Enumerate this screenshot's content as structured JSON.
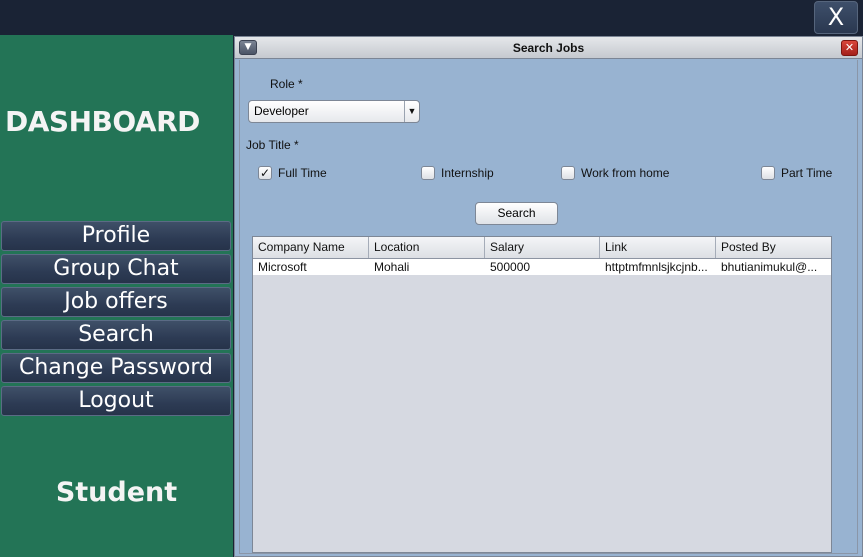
{
  "app": {
    "close_label": "X"
  },
  "sidebar": {
    "title": "DASHBOARD",
    "items": [
      {
        "label": "Profile"
      },
      {
        "label": "Group Chat"
      },
      {
        "label": "Job offers"
      },
      {
        "label": "Search"
      },
      {
        "label": "Change Password"
      },
      {
        "label": "Logout"
      }
    ],
    "user_role": "Student"
  },
  "frame": {
    "title": "Search Jobs",
    "menu_icon": "▼",
    "close_icon": "✕"
  },
  "form": {
    "role_label": "Role *",
    "role_value": "Developer",
    "job_title_label": "Job Title *",
    "checkboxes": [
      {
        "label": "Full Time",
        "checked": true,
        "mark": "✓"
      },
      {
        "label": "Internship",
        "checked": false,
        "mark": ""
      },
      {
        "label": "Work from home",
        "checked": false,
        "mark": ""
      },
      {
        "label": "Part Time",
        "checked": false,
        "mark": ""
      }
    ],
    "search_label": "Search"
  },
  "table": {
    "columns": [
      "Company Name",
      "Location",
      "Salary",
      "Link",
      "Posted By"
    ],
    "rows": [
      [
        "Microsoft",
        "Mohali",
        "500000",
        "httptmfmnlsjkcjnb...",
        "bhutianimukul@..."
      ]
    ]
  }
}
